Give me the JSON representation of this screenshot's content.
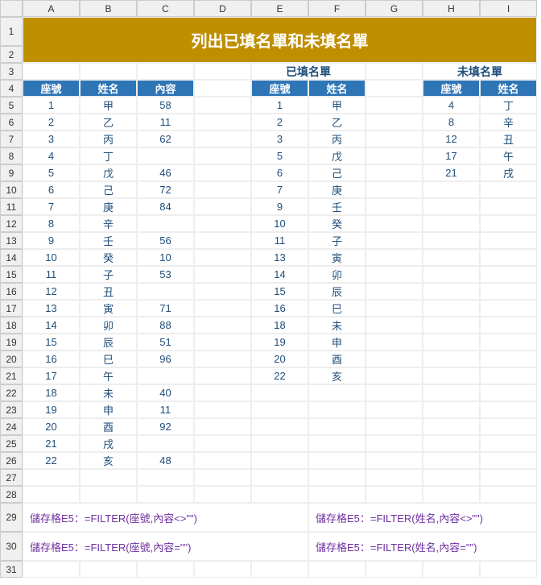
{
  "title": "列出已填名單和未填名單",
  "sect": {
    "filled": "已填名單",
    "unfilled": "未填名單"
  },
  "cols": [
    "",
    "A",
    "B",
    "C",
    "D",
    "E",
    "F",
    "G",
    "H",
    "I"
  ],
  "th": {
    "seat": "座號",
    "name": "姓名",
    "content": "內容"
  },
  "main": {
    "seat": [
      1,
      2,
      3,
      4,
      5,
      6,
      7,
      8,
      9,
      10,
      11,
      12,
      13,
      14,
      15,
      16,
      17,
      18,
      19,
      20,
      21,
      22
    ],
    "name": [
      "甲",
      "乙",
      "丙",
      "丁",
      "戊",
      "己",
      "庚",
      "辛",
      "壬",
      "癸",
      "子",
      "丑",
      "寅",
      "卯",
      "辰",
      "巳",
      "午",
      "未",
      "申",
      "酉",
      "戌",
      "亥"
    ],
    "content": [
      "58",
      "11",
      "62",
      "",
      "46",
      "72",
      "84",
      "",
      "56",
      "10",
      "53",
      "",
      "71",
      "88",
      "51",
      "96",
      "",
      "40",
      "11",
      "92",
      "",
      "48"
    ]
  },
  "filled": {
    "seat": [
      1,
      2,
      3,
      5,
      6,
      7,
      9,
      10,
      11,
      13,
      14,
      15,
      16,
      18,
      19,
      20,
      22
    ],
    "name": [
      "甲",
      "乙",
      "丙",
      "戊",
      "己",
      "庚",
      "壬",
      "癸",
      "子",
      "寅",
      "卯",
      "辰",
      "巳",
      "未",
      "申",
      "酉",
      "亥"
    ]
  },
  "unfilled": {
    "seat": [
      4,
      8,
      12,
      17,
      21
    ],
    "name": [
      "丁",
      "辛",
      "丑",
      "午",
      "戌"
    ]
  },
  "formulas": {
    "f1": "儲存格E5：=FILTER(座號,內容<>\"\")",
    "f2": "儲存格E5：=FILTER(姓名,內容<>\"\")",
    "f3": "儲存格E5：=FILTER(座號,內容=\"\")",
    "f4": "儲存格E5：=FILTER(姓名,內容=\"\")"
  }
}
